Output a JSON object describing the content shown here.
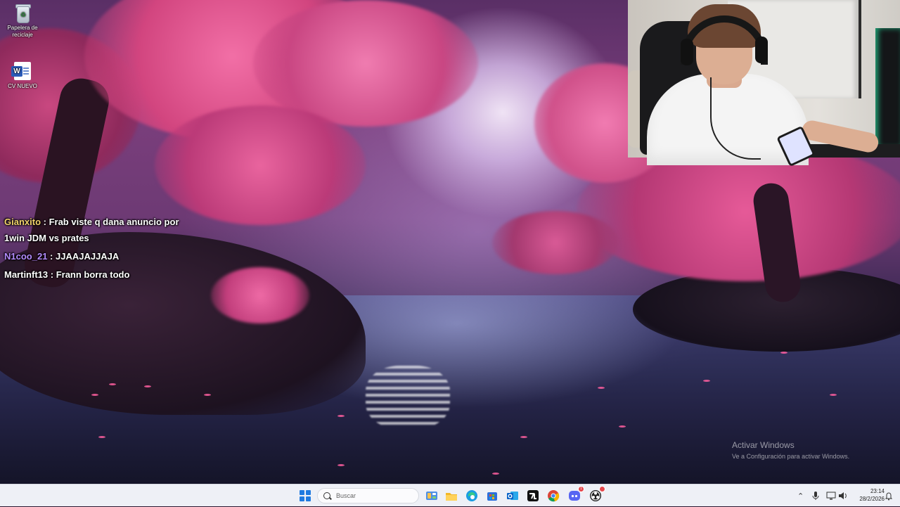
{
  "desktop": {
    "icons": [
      {
        "label": "Papelera de reciclaje",
        "icon": "recycle-bin-icon"
      },
      {
        "label": "CV NUEVO",
        "icon": "word-document-icon"
      }
    ]
  },
  "chat": {
    "messages": [
      {
        "user": "Gianxito",
        "separator": " : ",
        "text": "Frab viste q dana anuncio por 1win JDM vs prates",
        "user_color": "#f2d36b"
      },
      {
        "user": "N1coo_21",
        "separator": " : ",
        "text": "JJAAJAJJAJA",
        "user_color": "#b48cff"
      },
      {
        "user": "Martinft13",
        "separator": " : ",
        "text": "Frann borra todo",
        "user_color": "#ffffff"
      }
    ]
  },
  "watermark": {
    "title": "Activar Windows",
    "subtitle": "Ve a Configuración para activar Windows."
  },
  "taskbar": {
    "search_placeholder": "Buscar",
    "apps": [
      {
        "name": "start-icon"
      },
      {
        "name": "widgets-icon"
      },
      {
        "name": "file-explorer-icon"
      },
      {
        "name": "edge-icon"
      },
      {
        "name": "store-icon"
      },
      {
        "name": "outlook-icon"
      },
      {
        "name": "capcut-icon"
      },
      {
        "name": "chrome-icon"
      },
      {
        "name": "discord-icon",
        "badge": "1"
      },
      {
        "name": "obs-icon"
      }
    ],
    "clock": {
      "time": "23:14",
      "date": "28/2/2026"
    }
  },
  "colors": {
    "taskbar_bg": "#eef0f6",
    "accent": "#1f7ae0",
    "gianxito": "#f2d36b",
    "n1coo": "#b48cff"
  }
}
